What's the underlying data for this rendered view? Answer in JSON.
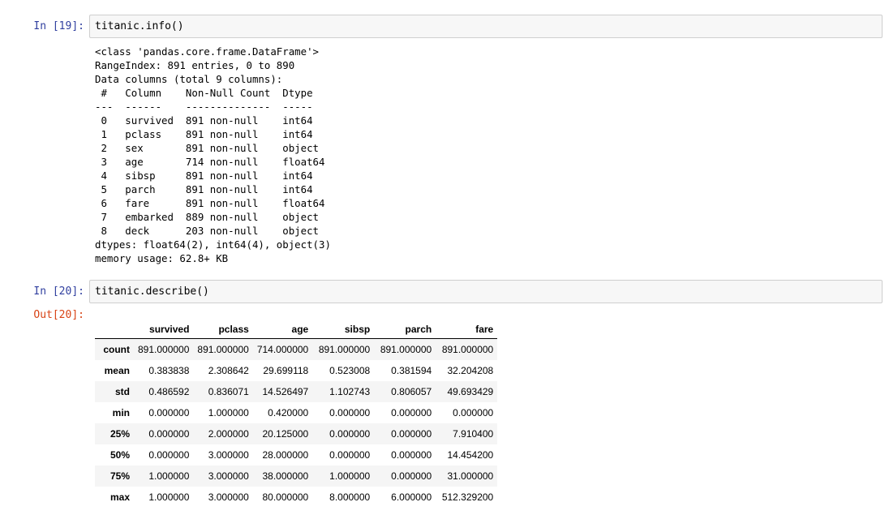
{
  "cells": [
    {
      "in_prompt": "In [19]:",
      "code": "titanic.info()",
      "stream_lines": [
        "<class 'pandas.core.frame.DataFrame'>",
        "RangeIndex: 891 entries, 0 to 890",
        "Data columns (total 9 columns):",
        " #   Column    Non-Null Count  Dtype  ",
        "---  ------    --------------  -----  ",
        " 0   survived  891 non-null    int64  ",
        " 1   pclass    891 non-null    int64  ",
        " 2   sex       891 non-null    object ",
        " 3   age       714 non-null    float64",
        " 4   sibsp     891 non-null    int64  ",
        " 5   parch     891 non-null    int64  ",
        " 6   fare      891 non-null    float64",
        " 7   embarked  889 non-null    object ",
        " 8   deck      203 non-null    object ",
        "dtypes: float64(2), int64(4), object(3)",
        "memory usage: 62.8+ KB"
      ]
    },
    {
      "in_prompt": "In [20]:",
      "code": "titanic.describe()",
      "out_prompt": "Out[20]:",
      "table": {
        "columns": [
          "survived",
          "pclass",
          "age",
          "sibsp",
          "parch",
          "fare"
        ],
        "rows": [
          {
            "index": "count",
            "values": [
              "891.000000",
              "891.000000",
              "714.000000",
              "891.000000",
              "891.000000",
              "891.000000"
            ]
          },
          {
            "index": "mean",
            "values": [
              "0.383838",
              "2.308642",
              "29.699118",
              "0.523008",
              "0.381594",
              "32.204208"
            ]
          },
          {
            "index": "std",
            "values": [
              "0.486592",
              "0.836071",
              "14.526497",
              "1.102743",
              "0.806057",
              "49.693429"
            ]
          },
          {
            "index": "min",
            "values": [
              "0.000000",
              "1.000000",
              "0.420000",
              "0.000000",
              "0.000000",
              "0.000000"
            ]
          },
          {
            "index": "25%",
            "values": [
              "0.000000",
              "2.000000",
              "20.125000",
              "0.000000",
              "0.000000",
              "7.910400"
            ]
          },
          {
            "index": "50%",
            "values": [
              "0.000000",
              "3.000000",
              "28.000000",
              "0.000000",
              "0.000000",
              "14.454200"
            ]
          },
          {
            "index": "75%",
            "values": [
              "1.000000",
              "3.000000",
              "38.000000",
              "1.000000",
              "0.000000",
              "31.000000"
            ]
          },
          {
            "index": "max",
            "values": [
              "1.000000",
              "3.000000",
              "80.000000",
              "8.000000",
              "6.000000",
              "512.329200"
            ]
          }
        ]
      }
    }
  ],
  "colors": {
    "in_prompt": "#303f9f",
    "out_prompt": "#d84315",
    "input_bg": "#f7f7f7",
    "input_border": "#cfcfcf",
    "row_stripe": "#f5f5f5"
  }
}
